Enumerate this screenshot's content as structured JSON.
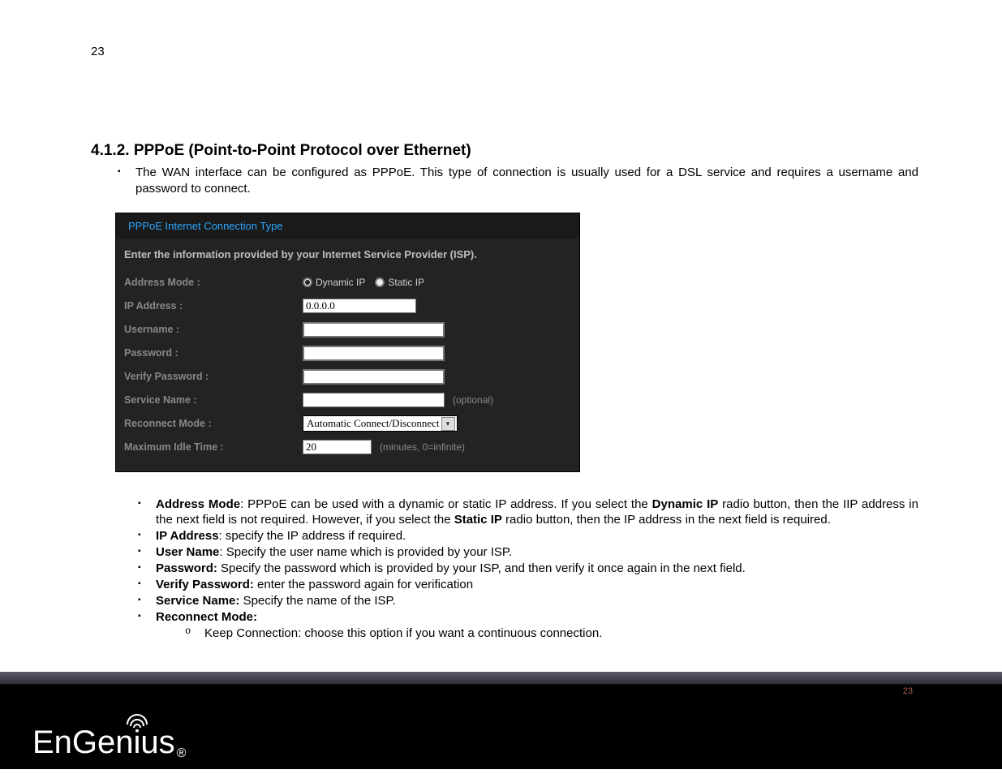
{
  "page": {
    "top_number": "23",
    "footer_number": "23"
  },
  "section": {
    "heading": "4.1.2. PPPoE (Point-to-Point Protocol over Ethernet)",
    "intro": "The WAN interface can be configured as PPPoE. This type of connection is usually used for a DSL service and requires a username and password to connect."
  },
  "panel": {
    "title": "PPPoE Internet Connection Type",
    "description": "Enter the information provided by your Internet Service Provider (ISP).",
    "labels": {
      "address_mode": "Address Mode :",
      "ip_address": "IP Address :",
      "username": "Username :",
      "password": "Password :",
      "verify_password": "Verify Password :",
      "service_name": "Service Name :",
      "reconnect_mode": "Reconnect Mode :",
      "max_idle": "Maximum Idle Time :"
    },
    "radio": {
      "dynamic": "Dynamic IP",
      "static": "Static IP",
      "selected": "dynamic"
    },
    "values": {
      "ip_address": "0.0.0.0",
      "username": "",
      "password": "",
      "verify_password": "",
      "service_name": "",
      "reconnect_mode": "Automatic Connect/Disconnect",
      "max_idle": "20"
    },
    "hints": {
      "service_name": "(optional)",
      "max_idle": "(minutes, 0=infinite)"
    }
  },
  "bullets": {
    "address_mode": {
      "label": "Address Mode",
      "before": ": PPPoE can be used with a dynamic or static IP address. If you select the ",
      "bold1": "Dynamic IP",
      "mid": " radio button, then the IIP address in the next field is not required. However, if you select the ",
      "bold2": "Static IP",
      "after": " radio button, then the IP address in the next field is required."
    },
    "ip_address": {
      "label": "IP Address",
      "text": ": specify the IP address if required."
    },
    "user_name": {
      "label": "User Name",
      "text": ": Specify the user name which is provided by your ISP."
    },
    "password": {
      "label": "Password:",
      "text": " Specify the password which is provided by your ISP, and then verify it once again in the next field."
    },
    "verify_password": {
      "label": "Verify Password:",
      "text": " enter the password again for verification"
    },
    "service_name": {
      "label": "Service Name:",
      "text": " Specify the name of the ISP."
    },
    "reconnect_mode": {
      "label": "Reconnect Mode:"
    },
    "reconnect_sub": "Keep Connection: choose this option if you want a continuous connection."
  },
  "logo": {
    "text_a": "EnGen",
    "text_b": "us",
    "reg": "®"
  }
}
